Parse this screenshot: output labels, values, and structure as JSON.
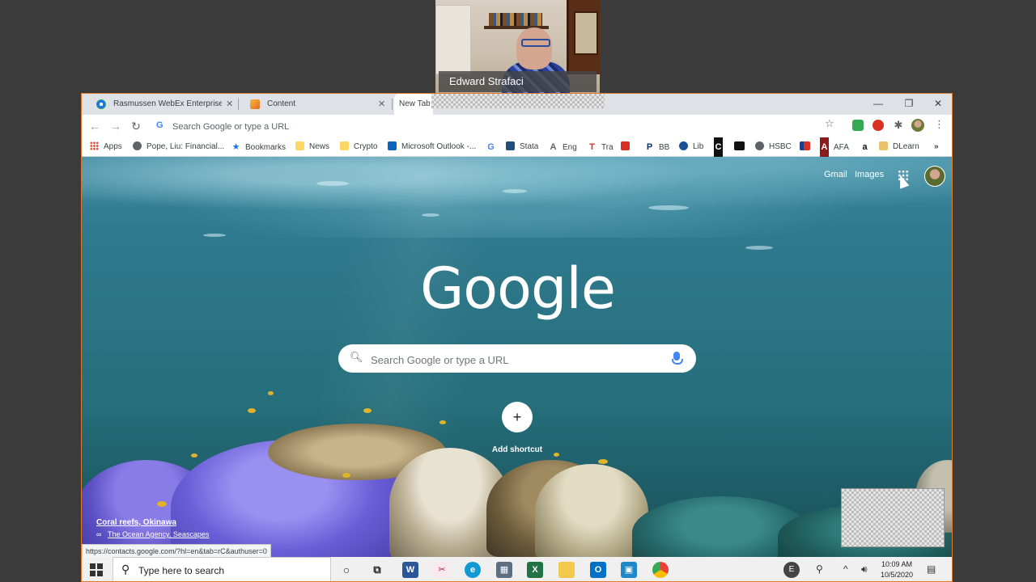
{
  "webcam": {
    "participant_name": "Edward Strafaci"
  },
  "tabs": [
    {
      "title": "Rasmussen WebEx Enterprise Sit",
      "close": "✕"
    },
    {
      "title": "Content",
      "close": "✕"
    },
    {
      "title": "New Tab"
    }
  ],
  "window_controls": {
    "minimize": "—",
    "restore": "❐",
    "close": "✕"
  },
  "toolbar": {
    "back": "←",
    "forward": "→",
    "reload": "↻",
    "omnibox_placeholder": "Search Google or type a URL",
    "star": "☆",
    "menu": "⋮"
  },
  "bookmarks": [
    {
      "label": "Apps"
    },
    {
      "label": "Pope, Liu: Financial..."
    },
    {
      "label": "Bookmarks"
    },
    {
      "label": "News"
    },
    {
      "label": "Crypto"
    },
    {
      "label": "Microsoft Outlook -..."
    },
    {
      "label": ""
    },
    {
      "label": "Stata"
    },
    {
      "label": "Eng"
    },
    {
      "label": "Tra"
    },
    {
      "label": ""
    },
    {
      "label": "BB"
    },
    {
      "label": "Lib"
    },
    {
      "label": ""
    },
    {
      "label": ""
    },
    {
      "label": "HSBC"
    },
    {
      "label": ""
    },
    {
      "label": "AFA"
    },
    {
      "label": ""
    },
    {
      "label": "DLearn"
    },
    {
      "label": "»"
    }
  ],
  "bookmark_icons": {
    "google": "G",
    "tra": "T",
    "bb": "P",
    "c": "C",
    "afa": "A",
    "amazon": "a"
  },
  "newtab": {
    "gmail": "Gmail",
    "images": "Images",
    "logo": "Google",
    "search_placeholder": "Search Google or type a URL",
    "add_shortcut_symbol": "+",
    "add_shortcut_label": "Add shortcut",
    "background_title": "Coral reefs, Okinawa",
    "background_credit": "The Ocean Agency, Seascapes"
  },
  "status_url": "https://contacts.google.com/?hl=en&tab=rC&authuser=0",
  "taskbar": {
    "search_placeholder": "Type here to search",
    "user_initial": "E",
    "time": "10:09 AM",
    "date": "10/5/2020"
  },
  "colors": {
    "window_border": "#e07a2a",
    "tabstrip": "#dee1e6",
    "taskbar": "#f0f0f0"
  }
}
